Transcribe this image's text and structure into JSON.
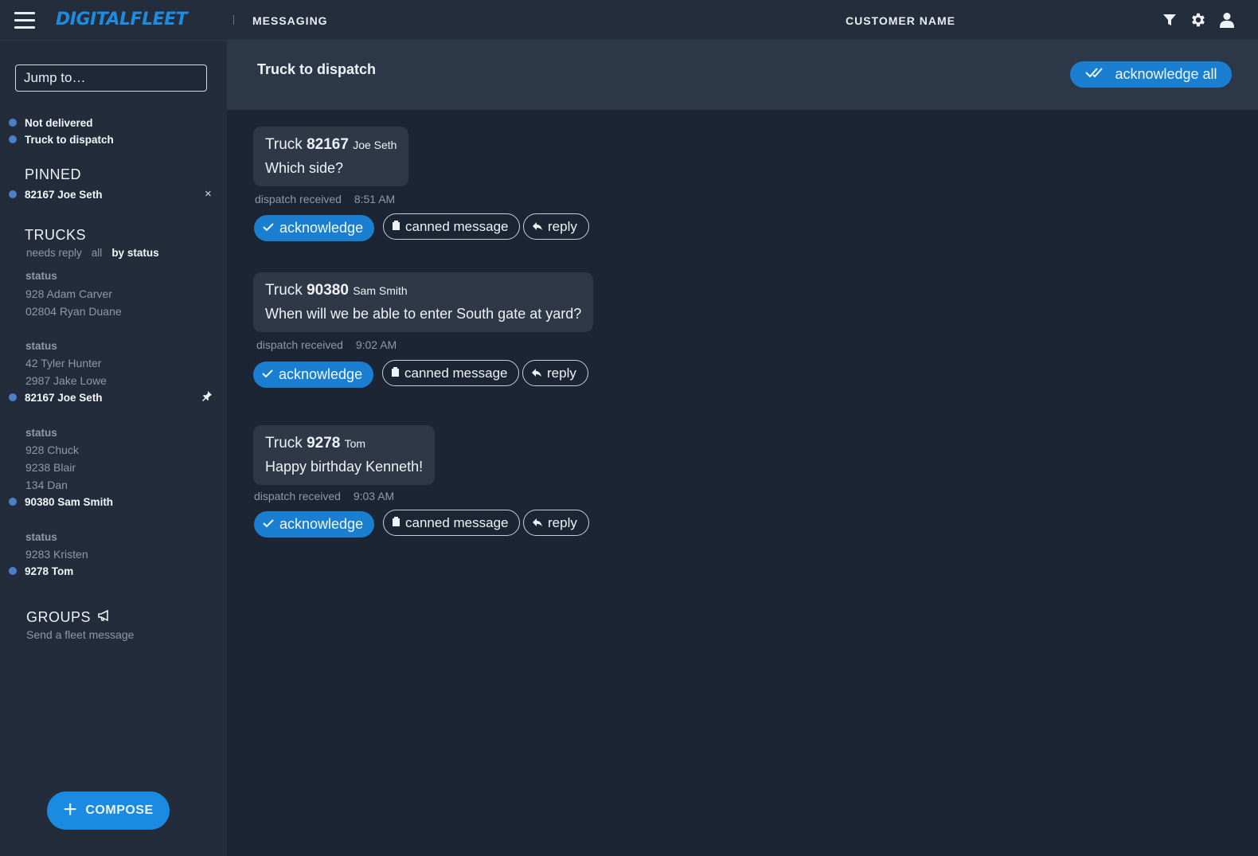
{
  "header": {
    "logo": "DIGITALFLEET",
    "app_title": "MESSAGING",
    "customer": "CUSTOMER NAME"
  },
  "sidebar": {
    "jump_placeholder": "Jump to…",
    "folders": [
      {
        "label": "Not delivered"
      },
      {
        "label": "Truck to dispatch"
      }
    ],
    "pinned": {
      "heading": "PINNED",
      "items": [
        {
          "label": "82167 Joe Seth",
          "remove": "×"
        }
      ]
    },
    "trucks": {
      "heading": "TRUCKS",
      "filters": [
        "needs reply",
        "all",
        "by status"
      ],
      "groups": [
        {
          "status": "status",
          "items": [
            "928 Adam Carver",
            "02804 Ryan Duane"
          ]
        },
        {
          "status": "status",
          "items": [
            "42 Tyler Hunter",
            "2987 Jake Lowe"
          ],
          "highlight": "82167 Joe Seth"
        },
        {
          "status": "status",
          "items": [
            "928 Chuck",
            "9238 Blair",
            "134 Dan"
          ],
          "highlight": "90380 Sam Smith"
        },
        {
          "status": "status",
          "items": [
            "9283 Kristen"
          ],
          "highlight": "9278 Tom"
        }
      ]
    },
    "groups": {
      "heading": "GROUPS",
      "subtitle": "Send a fleet message"
    },
    "compose_label": "COMPOSE"
  },
  "main": {
    "title": "Truck to dispatch",
    "ack_all_label": "acknowledge all",
    "messages": [
      {
        "prefix": "Truck",
        "truck": "82167",
        "driver": "Joe Seth",
        "body": "Which side?",
        "status": "dispatch received",
        "time": "8:51 AM"
      },
      {
        "prefix": "Truck",
        "truck": "90380",
        "driver": "Sam Smith",
        "body": "When will we be able to enter South gate at yard?",
        "status": "dispatch received",
        "time": "9:02 AM"
      },
      {
        "prefix": "Truck",
        "truck": "9278",
        "driver": "Tom",
        "body": "Happy birthday Kenneth!",
        "status": "dispatch received",
        "time": "9:03 AM"
      }
    ],
    "actions": {
      "acknowledge": "acknowledge",
      "canned": "canned message",
      "reply": "reply"
    }
  },
  "colors": {
    "accent": "#1a7fd0",
    "background": "#1b2533",
    "sidebar": "#222c3a",
    "status_dot": "#4d7ec9"
  }
}
